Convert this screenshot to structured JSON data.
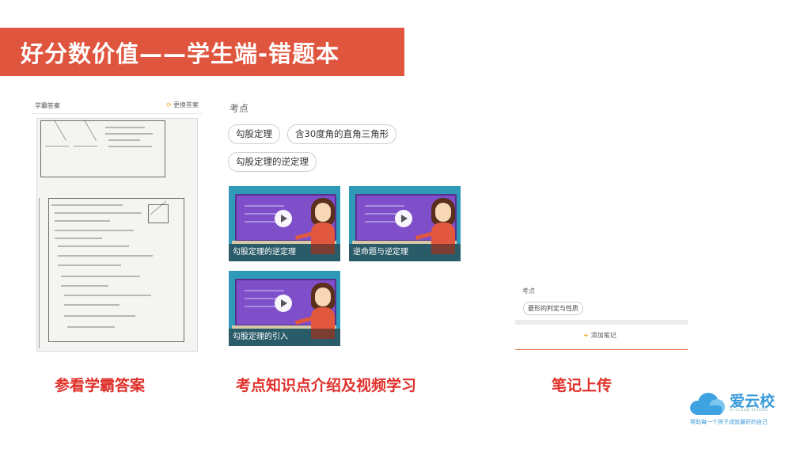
{
  "header": {
    "title": "好分数价值——学生端-错题本"
  },
  "answer_panel": {
    "label": "学霸答案",
    "refresh_label": "更换答案"
  },
  "knowledge_panel": {
    "label": "考点",
    "chips": [
      "勾股定理",
      "含30度角的直角三角形",
      "勾股定理的逆定理"
    ],
    "videos": [
      {
        "title": "勾股定理的逆定理"
      },
      {
        "title": "逆命题与逆定理"
      },
      {
        "title": "勾股定理的引入"
      }
    ]
  },
  "notes_panel": {
    "label": "考点",
    "chip": "菱形的判定与性质",
    "add_label": "添加笔记"
  },
  "captions": {
    "answer": "参看学霸答案",
    "knowledge": "考点知识点介绍及视频学习",
    "notes": "笔记上传"
  },
  "logo": {
    "name": "爱云校",
    "english": "AI CLOUD SCHOOL",
    "slogan": "帮助每一个孩子成就最好的自己"
  },
  "colors": {
    "accent": "#e0553e",
    "caption": "#e0302a",
    "video_bg": "#2e9ab7",
    "logo": "#3a9ad9"
  }
}
